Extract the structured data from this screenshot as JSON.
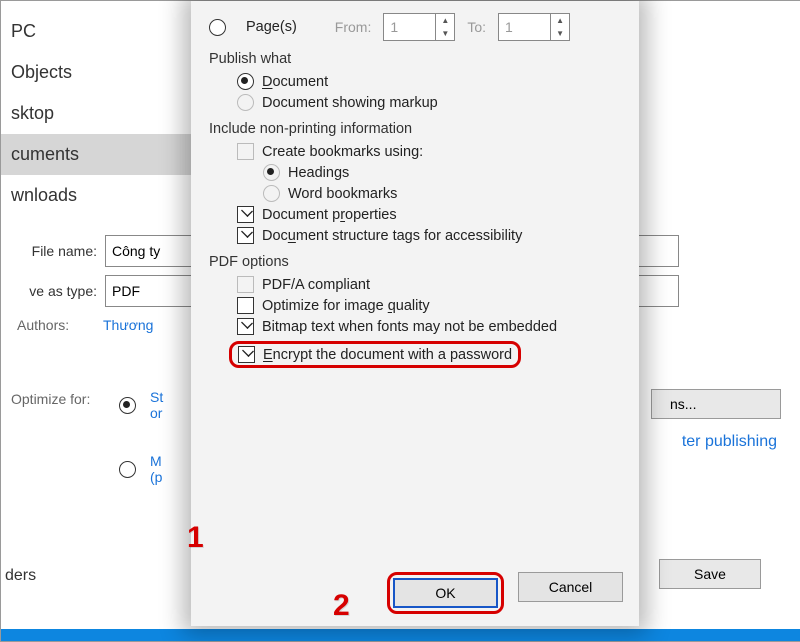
{
  "nav": {
    "items": [
      "PC",
      "Objects",
      "sktop",
      "cuments",
      "wnloads"
    ]
  },
  "file_row": {
    "label": "File name:",
    "value": "Công ty"
  },
  "type_row": {
    "label": "ve as type:",
    "value": "PDF"
  },
  "authors": {
    "label": "Authors:",
    "value": "Thương"
  },
  "optimize": {
    "label": "Optimize for:",
    "opt1a": "St",
    "opt1b": "or",
    "opt2a": "M",
    "opt2b": "(p"
  },
  "options_btn": "ns...",
  "open_after": "ter publishing",
  "folders": "ders",
  "save_btn": "Save",
  "modal": {
    "pages_label": "Page(s)",
    "from": "From:",
    "from_v": "1",
    "to": "To:",
    "to_v": "1",
    "publish_what": "Publish what",
    "document": "Document",
    "doc_markup": "Document showing markup",
    "include_np": "Include non-printing information",
    "create_bm": "Create bookmarks using:",
    "headings": "Headings",
    "word_bm": "Word bookmarks",
    "doc_props": "Document properties",
    "doc_struct": "Document structure tags for accessibility",
    "pdf_opts": "PDF options",
    "pdfa": "PDF/A compliant",
    "opt_img": "Optimize for image quality",
    "bitmap": "Bitmap text when fonts may not be embedded",
    "encrypt": "Encrypt the document with a password",
    "ok": "OK",
    "cancel": "Cancel"
  },
  "annot": {
    "one": "1",
    "two": "2"
  }
}
